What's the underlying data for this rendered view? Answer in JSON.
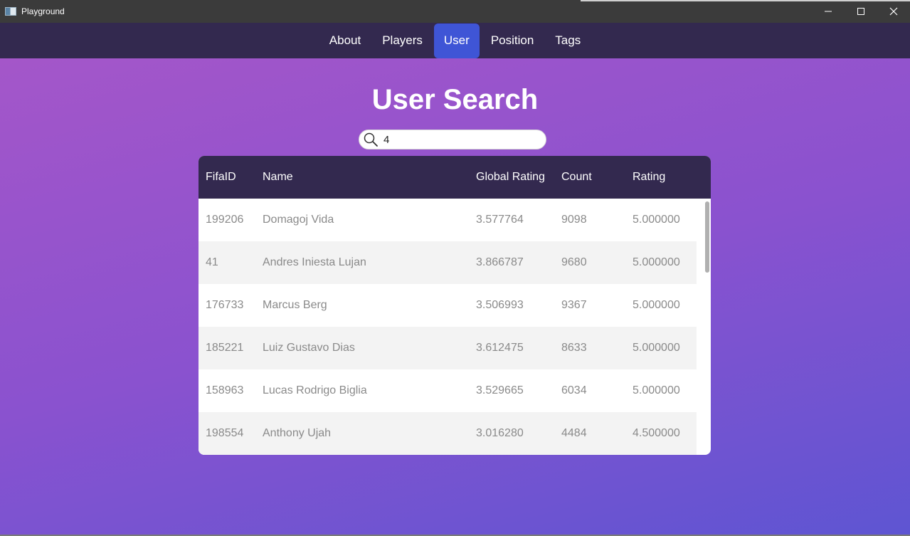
{
  "window": {
    "title": "Playground",
    "controls": {
      "minimize": "—",
      "maximize": "☐",
      "close": "✕"
    }
  },
  "nav": {
    "tabs": [
      {
        "label": "About",
        "active": false
      },
      {
        "label": "Players",
        "active": false
      },
      {
        "label": "User",
        "active": true
      },
      {
        "label": "Position",
        "active": false
      },
      {
        "label": "Tags",
        "active": false
      }
    ]
  },
  "page": {
    "title": "User Search",
    "search": {
      "value": "4",
      "icon": "search-icon"
    }
  },
  "table": {
    "headers": [
      "FifaID",
      "Name",
      "Global Rating",
      "Count",
      "Rating"
    ],
    "rows": [
      {
        "fifaid": "199206",
        "name": "Domagoj Vida",
        "global_rating": "3.577764",
        "count": "9098",
        "rating": "5.000000"
      },
      {
        "fifaid": "41",
        "name": "Andres Iniesta Lujan",
        "global_rating": "3.866787",
        "count": "9680",
        "rating": "5.000000"
      },
      {
        "fifaid": "176733",
        "name": "Marcus Berg",
        "global_rating": "3.506993",
        "count": "9367",
        "rating": "5.000000"
      },
      {
        "fifaid": "185221",
        "name": "Luiz Gustavo Dias",
        "global_rating": "3.612475",
        "count": "8633",
        "rating": "5.000000"
      },
      {
        "fifaid": "158963",
        "name": "Lucas Rodrigo Biglia",
        "global_rating": "3.529665",
        "count": "6034",
        "rating": "5.000000"
      },
      {
        "fifaid": "198554",
        "name": "Anthony Ujah",
        "global_rating": "3.016280",
        "count": "4484",
        "rating": "4.500000"
      }
    ]
  },
  "colors": {
    "navbar": "#33294f",
    "active_tab": "#3f55d6",
    "gradient_top": "#a456c9",
    "gradient_bottom": "#5e55d2"
  }
}
